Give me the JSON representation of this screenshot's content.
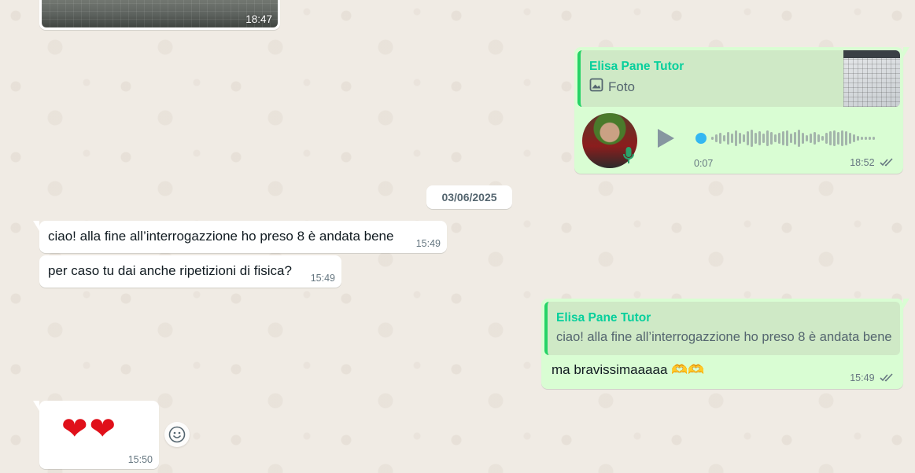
{
  "top_image_message": {
    "time": "18:47"
  },
  "audio_message": {
    "quote_author": "Elisa Pane Tutor",
    "quote_text": "Foto",
    "duration": "0:07",
    "time": "18:52",
    "status": "read"
  },
  "date_separator": "03/06/2025",
  "incoming_messages": [
    {
      "text": "ciao! alla fine all’interrogazzione ho preso 8 è andata bene",
      "time": "15:49"
    },
    {
      "text": "per caso tu dai anche ripetizioni di fisica?",
      "time": "15:49"
    }
  ],
  "reply_message": {
    "quote_author": "Elisa Pane Tutor",
    "quote_text": "ciao! alla fine all’interrogazzione ho preso 8 è andata bene",
    "text": "ma bravissimaaaaa",
    "emoji": "🫶🫶",
    "time": "15:49",
    "status": "read"
  },
  "hearts_message": {
    "text": "❤❤",
    "time": "15:50"
  },
  "colors": {
    "outgoing_bubble": "#d9fdd3",
    "incoming_bubble": "#ffffff",
    "quote_author": "#06cf9c",
    "read_ticks": "#667781",
    "audio_progress": "#34b7f1"
  },
  "icons": [
    "photo-icon",
    "play-icon",
    "mic-icon",
    "double-check-icon",
    "emoji-react-icon"
  ]
}
